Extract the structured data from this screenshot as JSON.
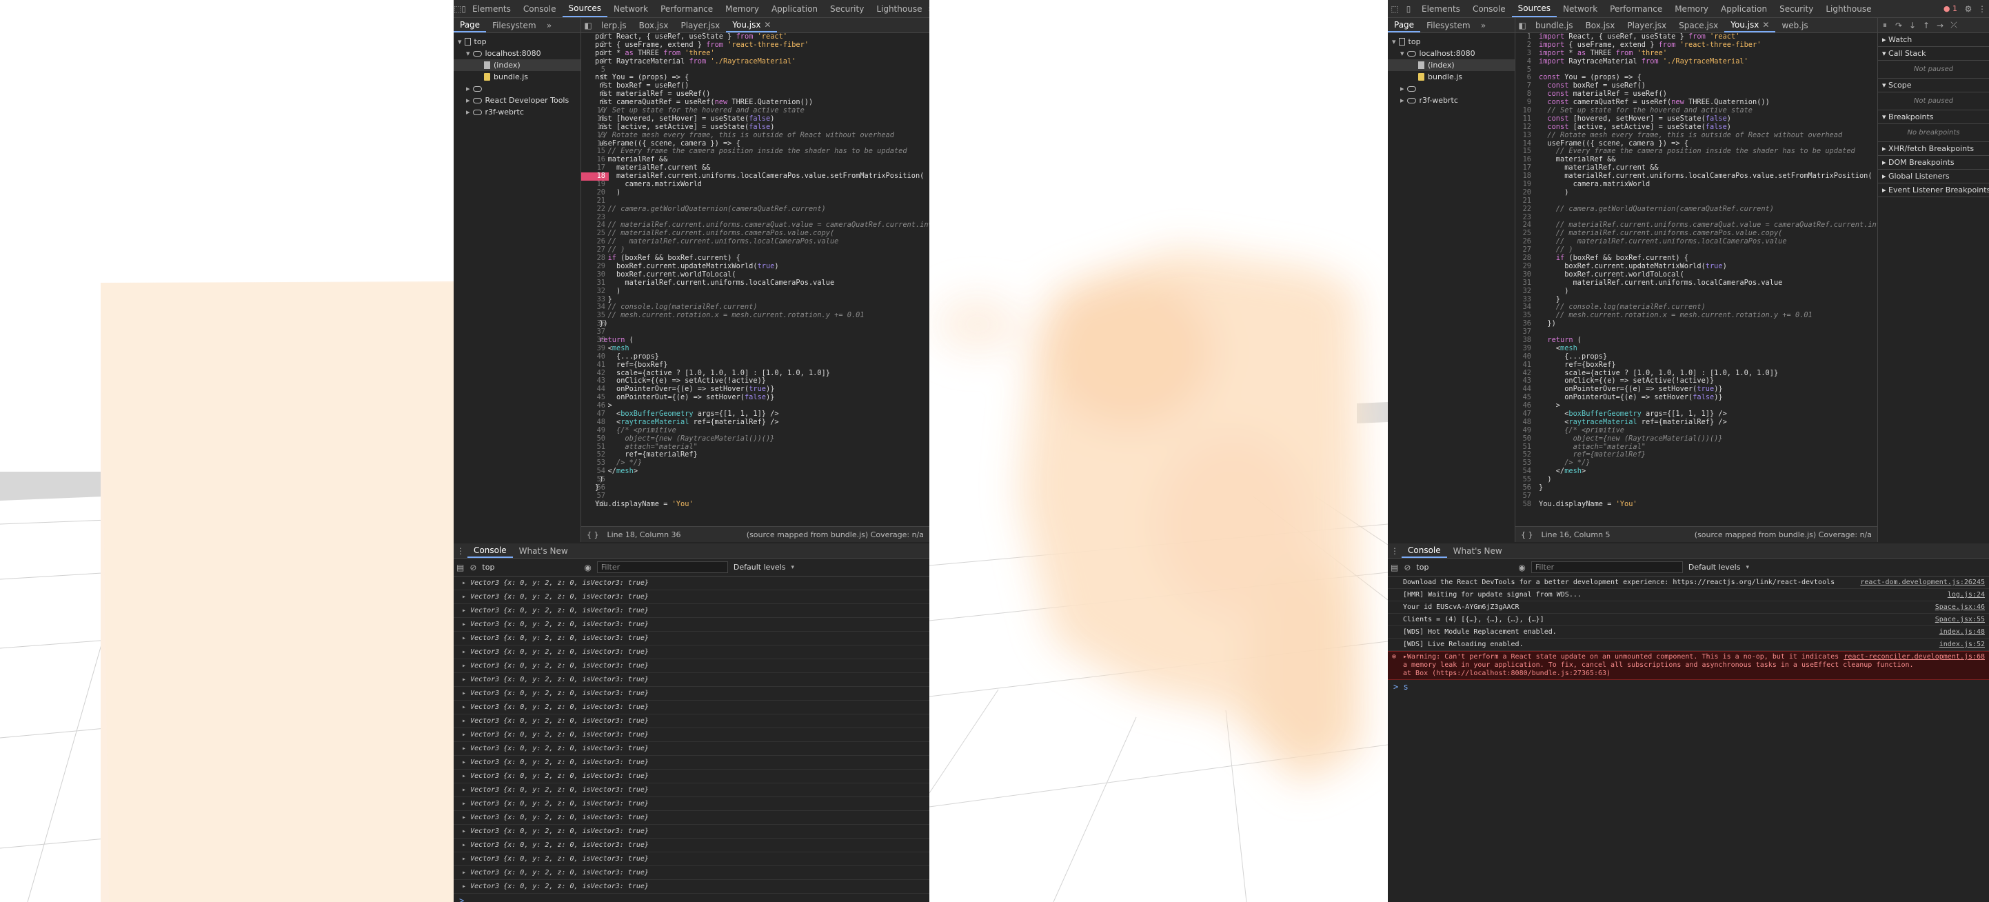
{
  "left_devtools": {
    "tabs": [
      "Elements",
      "Console",
      "Sources",
      "Network",
      "Performance",
      "Memory",
      "Application",
      "Security",
      "Lighthouse"
    ],
    "active_tab": "Sources",
    "nav_tabs": [
      "Page",
      "Filesystem"
    ],
    "tree": [
      "top",
      "localhost:8080",
      "(index)",
      "bundle.js",
      "",
      "React Developer Tools",
      "r3f-webrtc"
    ],
    "file_tabs": [
      "lerp.js",
      "Box.jsx",
      "Player.jsx",
      "You.jsx"
    ],
    "active_file": "You.jsx",
    "status_left": "Line 18, Column 36",
    "status_right": "(source mapped from bundle.js)  Coverage: n/a",
    "console_tabs": [
      "Console",
      "What's New"
    ],
    "context": "top",
    "filter_placeholder": "Filter",
    "levels": "Default levels",
    "vector_row": "Vector3 {x: 0, y: 2, z: 0, isVector3: true}",
    "prompt": ">"
  },
  "right_devtools": {
    "tabs": [
      "Elements",
      "Console",
      "Sources",
      "Network",
      "Performance",
      "Memory",
      "Application",
      "Security",
      "Lighthouse"
    ],
    "active_tab": "Sources",
    "error_count": "1",
    "nav_tabs": [
      "Page",
      "Filesystem"
    ],
    "tree": [
      "top",
      "localhost:8080",
      "(index)",
      "bundle.js",
      "",
      "r3f-webrtc"
    ],
    "file_tabs": [
      "bundle.js",
      "Box.jsx",
      "Player.jsx",
      "Space.jsx",
      "You.jsx",
      "web.js"
    ],
    "active_file": "You.jsx",
    "status_left": "Line 16, Column 5",
    "status_right": "(source mapped from bundle.js)  Coverage: n/a",
    "debug_sections": [
      "Watch",
      "Call Stack",
      "Scope",
      "Breakpoints",
      "XHR/fetch Breakpoints",
      "DOM Breakpoints",
      "Global Listeners",
      "Event Listener Breakpoints"
    ],
    "not_paused": "Not paused",
    "no_breakpoints": "No breakpoints",
    "console_tabs": [
      "Console",
      "What's New"
    ],
    "context": "top",
    "filter_placeholder": "Filter",
    "levels": "Default levels",
    "messages": [
      {
        "text": "Download the React DevTools for a better development experience: https://reactjs.org/link/react-devtools",
        "src": "react-dom.development.js:26245"
      },
      {
        "text": "[HMR] Waiting for update signal from WDS...",
        "src": "log.js:24"
      },
      {
        "text": "Your id EUScvA-AYGm6jZ3gAACR",
        "src": "Space.jsx:46"
      },
      {
        "text": "Clients = (4) [{…}, {…}, {…}, {…}]",
        "src": "Space.jsx:55"
      },
      {
        "text": "[WDS] Hot Module Replacement enabled.",
        "src": "index.js:48"
      },
      {
        "text": "[WDS] Live Reloading enabled.",
        "src": "index.js:52"
      }
    ],
    "error_msg": [
      "▸Warning: Can't perform a React state update on an unmounted component. This is a no-op, but it indicates",
      "a memory leak in your application. To fix, cancel all subscriptions and asynchronous tasks in a useEffect cleanup function.",
      "    at Box (https://localhost:8080/bundle.js:27365:63)"
    ],
    "error_src": "react-reconciler.development.js:68",
    "prompt": "> s"
  }
}
